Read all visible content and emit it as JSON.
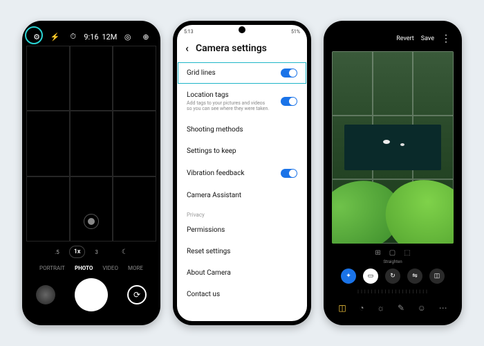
{
  "phone1": {
    "top_icons": {
      "settings": "⚙",
      "flash": "⚡",
      "timer": "⏱",
      "ratio": "9:16",
      "mp": "12M",
      "motion": "◎",
      "filter": "⊕"
    },
    "zoom": {
      "wide": ".5",
      "main": "1x",
      "tele": "3",
      "night": "☾"
    },
    "modes": {
      "portrait": "PORTRAIT",
      "photo": "PHOTO",
      "video": "VIDEO",
      "more": "MORE"
    },
    "switch_icon": "⟳"
  },
  "phone2": {
    "status": {
      "time": "5:13",
      "battery": "51%"
    },
    "header": {
      "back": "‹",
      "title": "Camera settings"
    },
    "rows": {
      "grid": "Grid lines",
      "location": "Location tags",
      "location_sub": "Add tags to your pictures and videos so you can see where they were taken.",
      "shooting": "Shooting methods",
      "keep": "Settings to keep",
      "vibration": "Vibration feedback",
      "assistant": "Camera Assistant",
      "privacy": "Privacy",
      "permissions": "Permissions",
      "reset": "Reset settings",
      "about": "About Camera",
      "contact": "Contact us"
    }
  },
  "phone3": {
    "header": {
      "revert": "Revert",
      "save": "Save",
      "more": "⋮"
    },
    "straighten": "Straighten",
    "tool_circles": {
      "auto": "✦",
      "crop": "▭",
      "rotate": "↻",
      "flip": "⇋",
      "persp": "◫"
    },
    "slider_ticks": "| | | | | | | | | | | | | | | | | | | | |",
    "bottom": {
      "crop": "◫",
      "filter": "◔",
      "adjust": "☼",
      "draw": "✎",
      "sticker": "☺",
      "more": "⋯"
    }
  }
}
